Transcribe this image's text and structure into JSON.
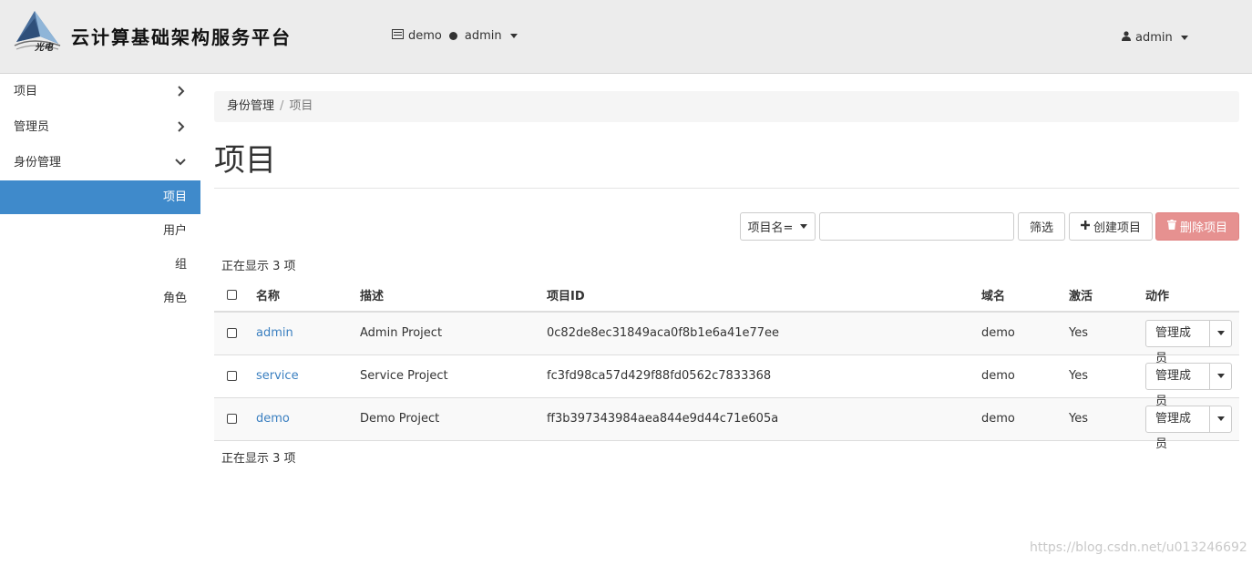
{
  "header": {
    "brand_title": "云计算基础架构服务平台",
    "logo_text": "光电",
    "context_project": "demo",
    "context_user": "admin",
    "user_menu": "admin"
  },
  "sidebar": {
    "items": [
      {
        "label": "项目",
        "state": "collapsed"
      },
      {
        "label": "管理员",
        "state": "collapsed"
      },
      {
        "label": "身份管理",
        "state": "expanded"
      }
    ],
    "sub_items": [
      {
        "label": "项目",
        "active": true
      },
      {
        "label": "用户",
        "active": false
      },
      {
        "label": "组",
        "active": false
      },
      {
        "label": "角色",
        "active": false
      }
    ]
  },
  "breadcrumb": {
    "parent": "身份管理",
    "separator": "/",
    "current": "项目"
  },
  "page_title": "项目",
  "toolbar": {
    "filter_field": "项目名=",
    "filter_value": "",
    "filter_button": "筛选",
    "create_button": "创建项目",
    "delete_button": "删除项目"
  },
  "count_top": "正在显示 3 项",
  "count_bottom": "正在显示 3 项",
  "table": {
    "columns": [
      "名称",
      "描述",
      "项目ID",
      "域名",
      "激活",
      "动作"
    ],
    "rows": [
      {
        "name": "admin",
        "description": "Admin Project",
        "id": "0c82de8ec31849aca0f8b1e6a41e77ee",
        "domain": "demo",
        "enabled": "Yes",
        "action": "管理成员"
      },
      {
        "name": "service",
        "description": "Service Project",
        "id": "fc3fd98ca57d429f88fd0562c7833368",
        "domain": "demo",
        "enabled": "Yes",
        "action": "管理成员"
      },
      {
        "name": "demo",
        "description": "Demo Project",
        "id": "ff3b397343984aea844e9d44c71e605a",
        "domain": "demo",
        "enabled": "Yes",
        "action": "管理成员"
      }
    ]
  },
  "watermark": "https://blog.csdn.net/u013246692",
  "colors": {
    "accent": "#3f8acb",
    "link": "#3a7fc0",
    "danger": "#e69190",
    "header_bg": "#ececec"
  },
  "icons": [
    "logo-mountain-icon",
    "server-icon",
    "user-icon",
    "chevron-right-icon",
    "chevron-down-icon",
    "plus-icon",
    "trash-icon",
    "caret-down-icon"
  ]
}
